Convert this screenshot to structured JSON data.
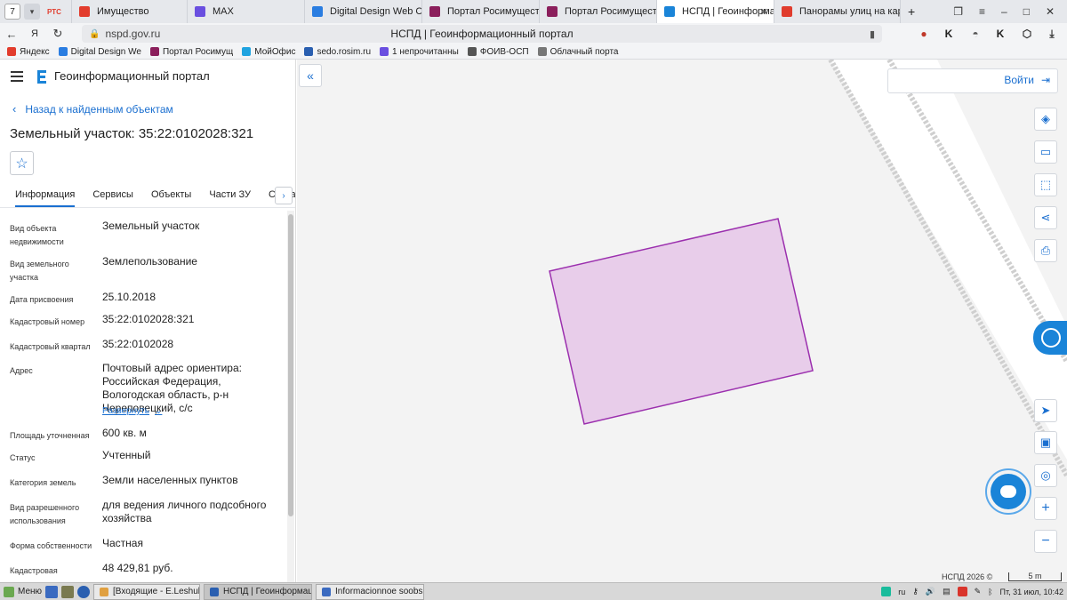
{
  "browser": {
    "tab_count": "7",
    "tabs": [
      {
        "label": "Имущество",
        "color": "#e23c2d"
      },
      {
        "label": "MAX",
        "color": "#6a4fe0"
      },
      {
        "label": "Digital Design Web Client",
        "color": "#2a7de1"
      },
      {
        "label": "Портал Росимущества",
        "color": "#8b1f5c"
      },
      {
        "label": "Портал Росимущества",
        "color": "#8b1f5c"
      },
      {
        "label": "НСПД | Геоинформац",
        "color": "#1a84d8"
      },
      {
        "label": "Панорамы улиц на карте",
        "color": "#e03c2d"
      }
    ],
    "active_tab_index": 5,
    "url_host": "nspd.gov.ru",
    "page_title": "НСПД | Геоинформационный портал",
    "bookmarks": [
      {
        "label": "Яндекс",
        "color": "#e23c2d"
      },
      {
        "label": "Digital Design We",
        "color": "#2a7de1"
      },
      {
        "label": "Портал Росимущ",
        "color": "#8b1f5c"
      },
      {
        "label": "МойОфис",
        "color": "#1fa3e0"
      },
      {
        "label": "sedo.rosim.ru",
        "color": "#2a5fb0"
      },
      {
        "label": "1 непрочитанны",
        "color": "#6a4fe0"
      },
      {
        "label": "ФОИВ-ОСП",
        "color": "#555555"
      },
      {
        "label": "Облачный порта",
        "color": "#777777"
      }
    ]
  },
  "panel": {
    "portal_name": "Геоинформационный портал",
    "back_link": "Назад к найденным объектам",
    "object_title": "Земельный участок: 35:22:0102028:321",
    "tabs": [
      "Информация",
      "Сервисы",
      "Объекты",
      "Части ЗУ",
      "Состав"
    ],
    "active_tab": 0,
    "fields": [
      {
        "label": "Вид объекта недвижимости",
        "value": "Земельный участок"
      },
      {
        "label": "Вид земельного участка",
        "value": "Землепользование"
      },
      {
        "label": "Дата присвоения",
        "value": "25.10.2018"
      },
      {
        "label": "Кадастровый номер",
        "value": "35:22:0102028:321"
      },
      {
        "label": "Кадастровый квартал",
        "value": "35:22:0102028"
      },
      {
        "label": "Адрес",
        "value": "Почтовый адрес ориентира: Российская Федерация, Вологодская область, р-н Череповецкий, с/с",
        "more": "Развернуть"
      },
      {
        "label": "Площадь уточненная",
        "value": "600 кв. м"
      },
      {
        "label": "Статус",
        "value": "Учтенный"
      },
      {
        "label": "Категория земель",
        "value": "Земли населенных пунктов"
      },
      {
        "label": "Вид разрешенного использования",
        "value": "для ведения личного подсобного хозяйства"
      },
      {
        "label": "Форма собственности",
        "value": "Частная"
      },
      {
        "label": "Кадастровая",
        "value": "48 429,81 руб."
      }
    ]
  },
  "map": {
    "login_label": "Войти",
    "copyright": "НСПД 2026 ©",
    "scale_label": "5 m",
    "parcel_fill": "#e8cdea",
    "parcel_stroke": "#9b2fae",
    "accent": "#1a6fd0"
  },
  "taskbar": {
    "start_label": "Меню",
    "tasks": [
      {
        "label": "[Входящие - E.Leshukov...",
        "color": "#e0a040"
      },
      {
        "label": "НСПД | Геоинформаци...",
        "color": "#2a5fb0"
      },
      {
        "label": "Informacionnoe soobsh...",
        "color": "#3a6ac0"
      }
    ],
    "active_task": 1,
    "lang": "ru",
    "clock": "Пт, 31 июл, 10:42"
  }
}
